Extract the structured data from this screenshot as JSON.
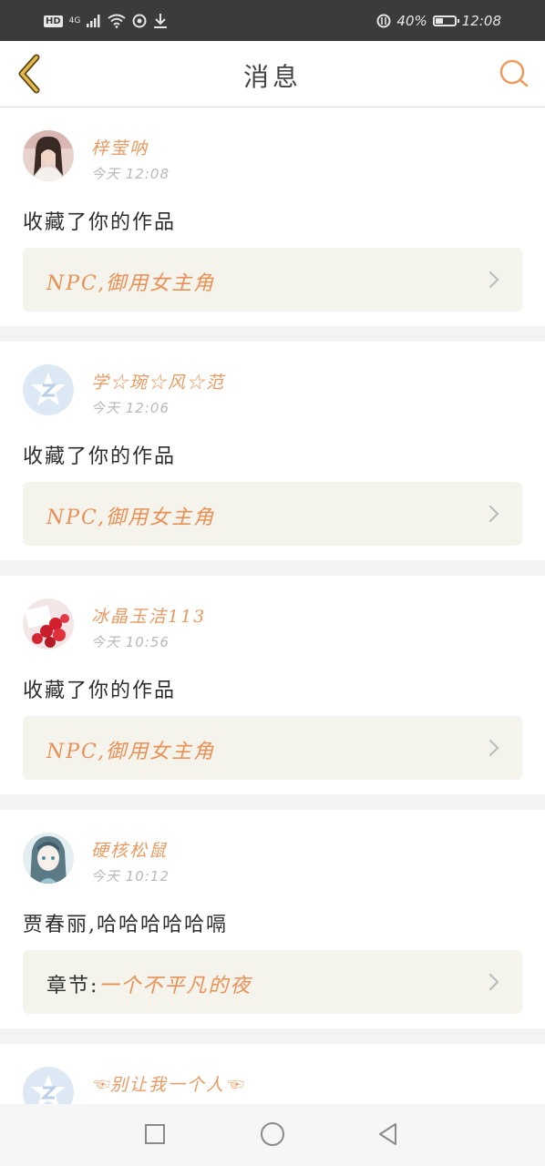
{
  "status_bar": {
    "network_badge": "HD",
    "network_type": "4G",
    "battery_percent": "40%",
    "battery_level": 0.4,
    "time": "12:08"
  },
  "header": {
    "title": "消息"
  },
  "colors": {
    "accent": "#e89a62",
    "back_arrow": "#e8b84a",
    "work_box_bg": "#f4f3ec"
  },
  "notifications": [
    {
      "username": "梓莹呐",
      "time": "今天 12:08",
      "message": "收藏了你的作品",
      "work_prefix": "",
      "work_title": "NPC,御用女主角",
      "avatar": "photo-girl"
    },
    {
      "username": "学☆琬☆风☆范",
      "time": "今天 12:06",
      "message": "收藏了你的作品",
      "work_prefix": "",
      "work_title": "NPC,御用女主角",
      "avatar": "default-z"
    },
    {
      "username": "冰晶玉洁113",
      "time": "今天 10:56",
      "message": "收藏了你的作品",
      "work_prefix": "",
      "work_title": "NPC,御用女主角",
      "avatar": "roses"
    },
    {
      "username": "硬核松鼠",
      "time": "今天 10:12",
      "message": "贾春丽,哈哈哈哈哈嗝",
      "work_prefix": "章节:",
      "work_title": "一个不平凡的夜",
      "avatar": "anime"
    },
    {
      "username": "☜别让我一个人☜",
      "avatar": "default-z"
    }
  ]
}
